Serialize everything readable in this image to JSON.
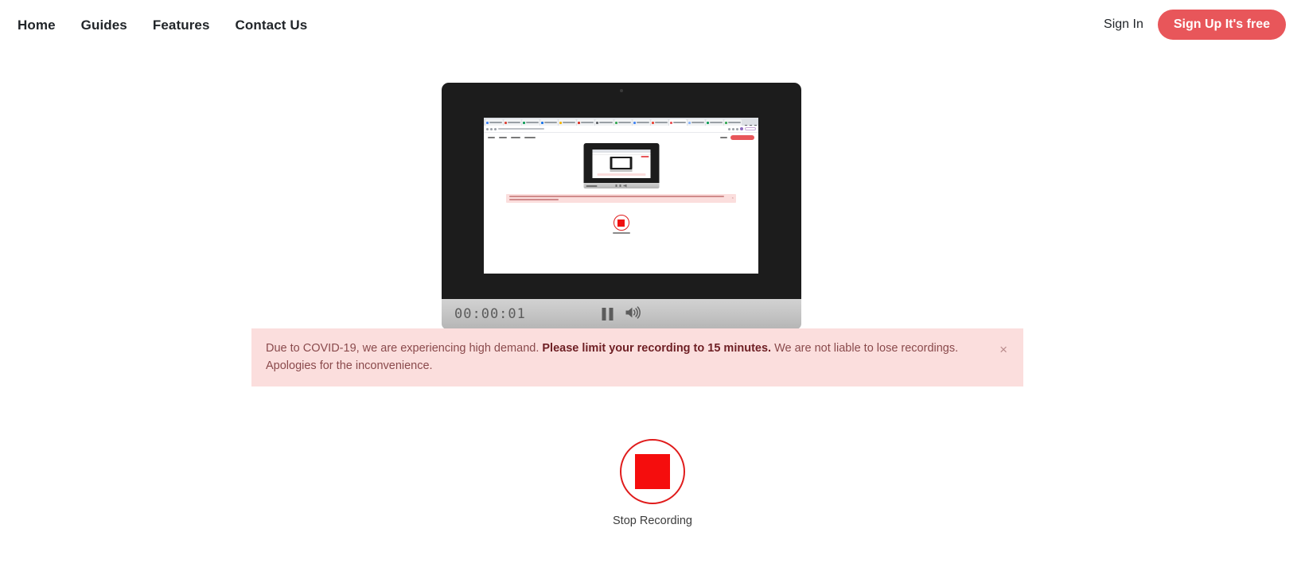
{
  "header": {
    "nav_items": [
      {
        "label": "Home"
      },
      {
        "label": "Guides"
      },
      {
        "label": "Features"
      },
      {
        "label": "Contact Us"
      }
    ],
    "signin_label": "Sign In",
    "signup_label": "Sign Up It's free",
    "accent_color": "#e8565a"
  },
  "preview": {
    "timer": "00:00:01",
    "pause_icon": "pause-icon",
    "volume_icon": "volume-up-icon",
    "webcam_icon": "webcam-dot-icon"
  },
  "alert": {
    "text_before": "Due to COVID-19, we are experiencing high demand. ",
    "text_bold": "Please limit your recording to 15 minutes.",
    "text_after": " We are not liable to lose recordings. Apologies for the inconvenience.",
    "close_label": "×",
    "background_color": "#fbdedd",
    "text_color": "#8a4a4c"
  },
  "recorder": {
    "stop_label": "Stop Recording",
    "stop_icon": "stop-square-icon",
    "record_color": "#f50d0d",
    "ring_color": "#e01c1c"
  }
}
